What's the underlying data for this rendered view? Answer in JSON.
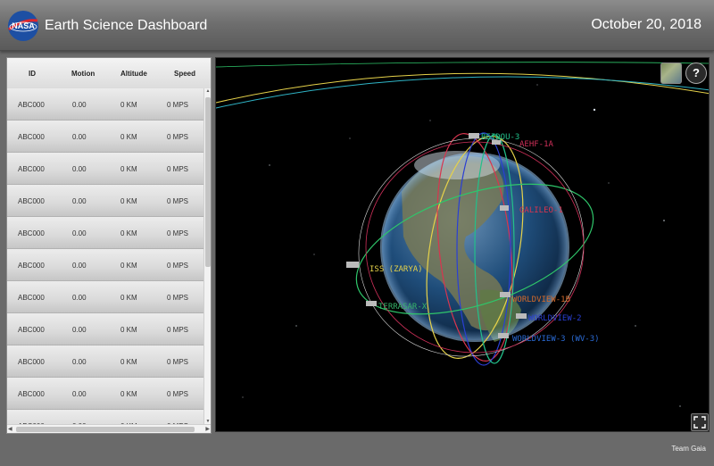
{
  "header": {
    "logo_text": "NASA",
    "title": "Earth Science Dashboard",
    "date": "October 20, 2018"
  },
  "table": {
    "columns": [
      "ID",
      "Motion",
      "Altitude",
      "Speed"
    ],
    "rows": [
      [
        "ABC000",
        "0.00",
        "0 KM",
        "0 MPS"
      ],
      [
        "ABC000",
        "0.00",
        "0 KM",
        "0 MPS"
      ],
      [
        "ABC000",
        "0.00",
        "0 KM",
        "0 MPS"
      ],
      [
        "ABC000",
        "0.00",
        "0 KM",
        "0 MPS"
      ],
      [
        "ABC000",
        "0.00",
        "0 KM",
        "0 MPS"
      ],
      [
        "ABC000",
        "0.00",
        "0 KM",
        "0 MPS"
      ],
      [
        "ABC000",
        "0.00",
        "0 KM",
        "0 MPS"
      ],
      [
        "ABC000",
        "0.00",
        "0 KM",
        "0 MPS"
      ],
      [
        "ABC000",
        "0.00",
        "0 KM",
        "0 MPS"
      ],
      [
        "ABC000",
        "0.00",
        "0 KM",
        "0 MPS"
      ],
      [
        "ABC000",
        "0.00",
        "0 KM",
        "0 MPS"
      ]
    ]
  },
  "globe": {
    "satellites": [
      {
        "label": "BEIDOU-3",
        "color": "#22c08a"
      },
      {
        "label": "AEHF-1A",
        "color": "#d0305a"
      },
      {
        "label": "GALILEO-1",
        "color": "#d8354f"
      },
      {
        "label": "ISS (ZARYA)",
        "color": "#e6d24a"
      },
      {
        "label": "TERRASAR-X",
        "color": "#35b46a"
      },
      {
        "label": "WORLDVIEW-1B",
        "color": "#d46a2a"
      },
      {
        "label": "WORLDVIEW-2",
        "color": "#2a3fd4"
      },
      {
        "label": "WORLDVIEW-3 (WV-3)",
        "color": "#2a6ad4"
      }
    ],
    "help_label": "?"
  },
  "footer": {
    "team": "Team Gaia"
  },
  "colors": {
    "header_bg": "#737373",
    "page_bg": "#6a6a6a",
    "space": "#000000"
  }
}
